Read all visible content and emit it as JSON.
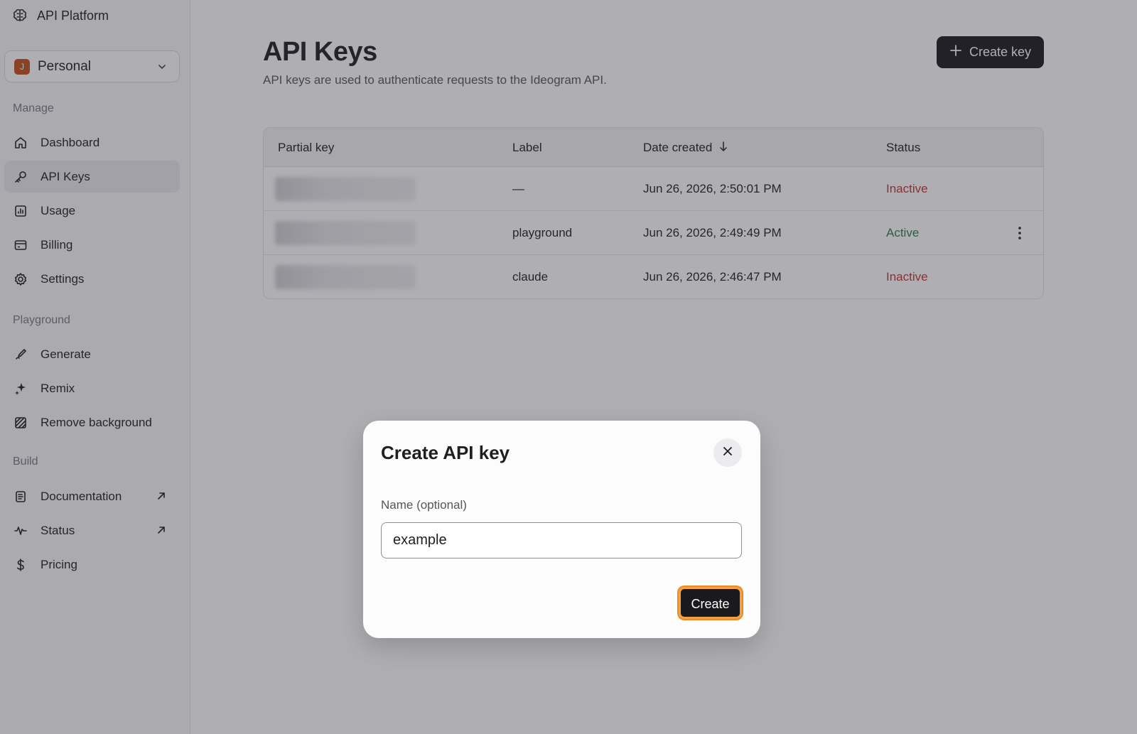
{
  "sidebar": {
    "brand": "API Platform",
    "workspace": {
      "avatar_letter": "J",
      "name": "Personal"
    },
    "sections": {
      "manage": "Manage",
      "playground": "Playground",
      "build": "Build"
    },
    "items": {
      "dashboard": "Dashboard",
      "api_keys": "API Keys",
      "usage": "Usage",
      "billing": "Billing",
      "settings": "Settings",
      "generate": "Generate",
      "remix": "Remix",
      "remove_background": "Remove background",
      "documentation": "Documentation",
      "status": "Status",
      "pricing": "Pricing"
    }
  },
  "main": {
    "title": "API Keys",
    "subtitle": "API keys are used to authenticate requests to the Ideogram API.",
    "create_key_label": "Create key"
  },
  "table": {
    "headers": {
      "partial_key": "Partial key",
      "label": "Label",
      "date_created": "Date created",
      "status": "Status"
    },
    "rows": [
      {
        "label": "—",
        "date": "Jun 26, 2026, 2:50:01 PM",
        "status": "Inactive"
      },
      {
        "label": "playground",
        "date": "Jun 26, 2026, 2:49:49 PM",
        "status": "Active"
      },
      {
        "label": "claude",
        "date": "Jun 26, 2026, 2:46:47 PM",
        "status": "Inactive"
      }
    ]
  },
  "modal": {
    "title": "Create API key",
    "field_label": "Name (optional)",
    "input_value": "example",
    "create_label": "Create"
  },
  "colors": {
    "inactive": "#c03535",
    "active": "#2e7d4a",
    "focus_ring": "#f08a1e",
    "primary_button": "#1a1a1d",
    "avatar": "#c4501e"
  }
}
